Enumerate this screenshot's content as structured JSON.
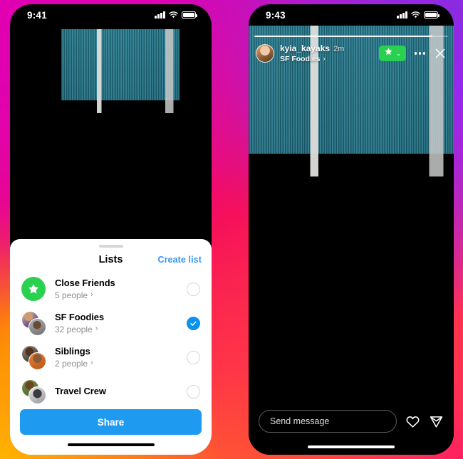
{
  "left_phone": {
    "status_bar": {
      "clock": "9:41"
    },
    "lists_sheet": {
      "title": "Lists",
      "create_list_label": "Create list",
      "items": [
        {
          "name": "Close Friends",
          "subtitle": "5 people",
          "chevron": "›",
          "selected": false,
          "avatar_type": "star"
        },
        {
          "name": "SF Foodies",
          "subtitle": "32 people",
          "chevron": "›",
          "selected": true,
          "avatar_type": "stack"
        },
        {
          "name": "Siblings",
          "subtitle": "2 people",
          "chevron": "›",
          "selected": false,
          "avatar_type": "stack"
        },
        {
          "name": "Travel Crew",
          "subtitle": "",
          "chevron": "",
          "selected": false,
          "avatar_type": "stack"
        }
      ],
      "share_button_label": "Share"
    }
  },
  "right_phone": {
    "status_bar": {
      "clock": "9:43"
    },
    "story": {
      "progress_percent": 92,
      "username": "kyia_kayaks",
      "timestamp": "2m",
      "list_name": "SF Foodies",
      "list_chevron": "›",
      "close_friends_badge_chevron": "⌄",
      "more_menu_label": "…",
      "close_label": "✕"
    },
    "footer": {
      "message_placeholder": "Send message",
      "message_value": ""
    }
  },
  "colors": {
    "instagram_blue": "#1e9bf0",
    "link_blue": "#3897f0",
    "close_friends_green": "#2ad04f",
    "selected_blue": "#0b91ee",
    "subtitle_gray": "#8e8e93"
  }
}
